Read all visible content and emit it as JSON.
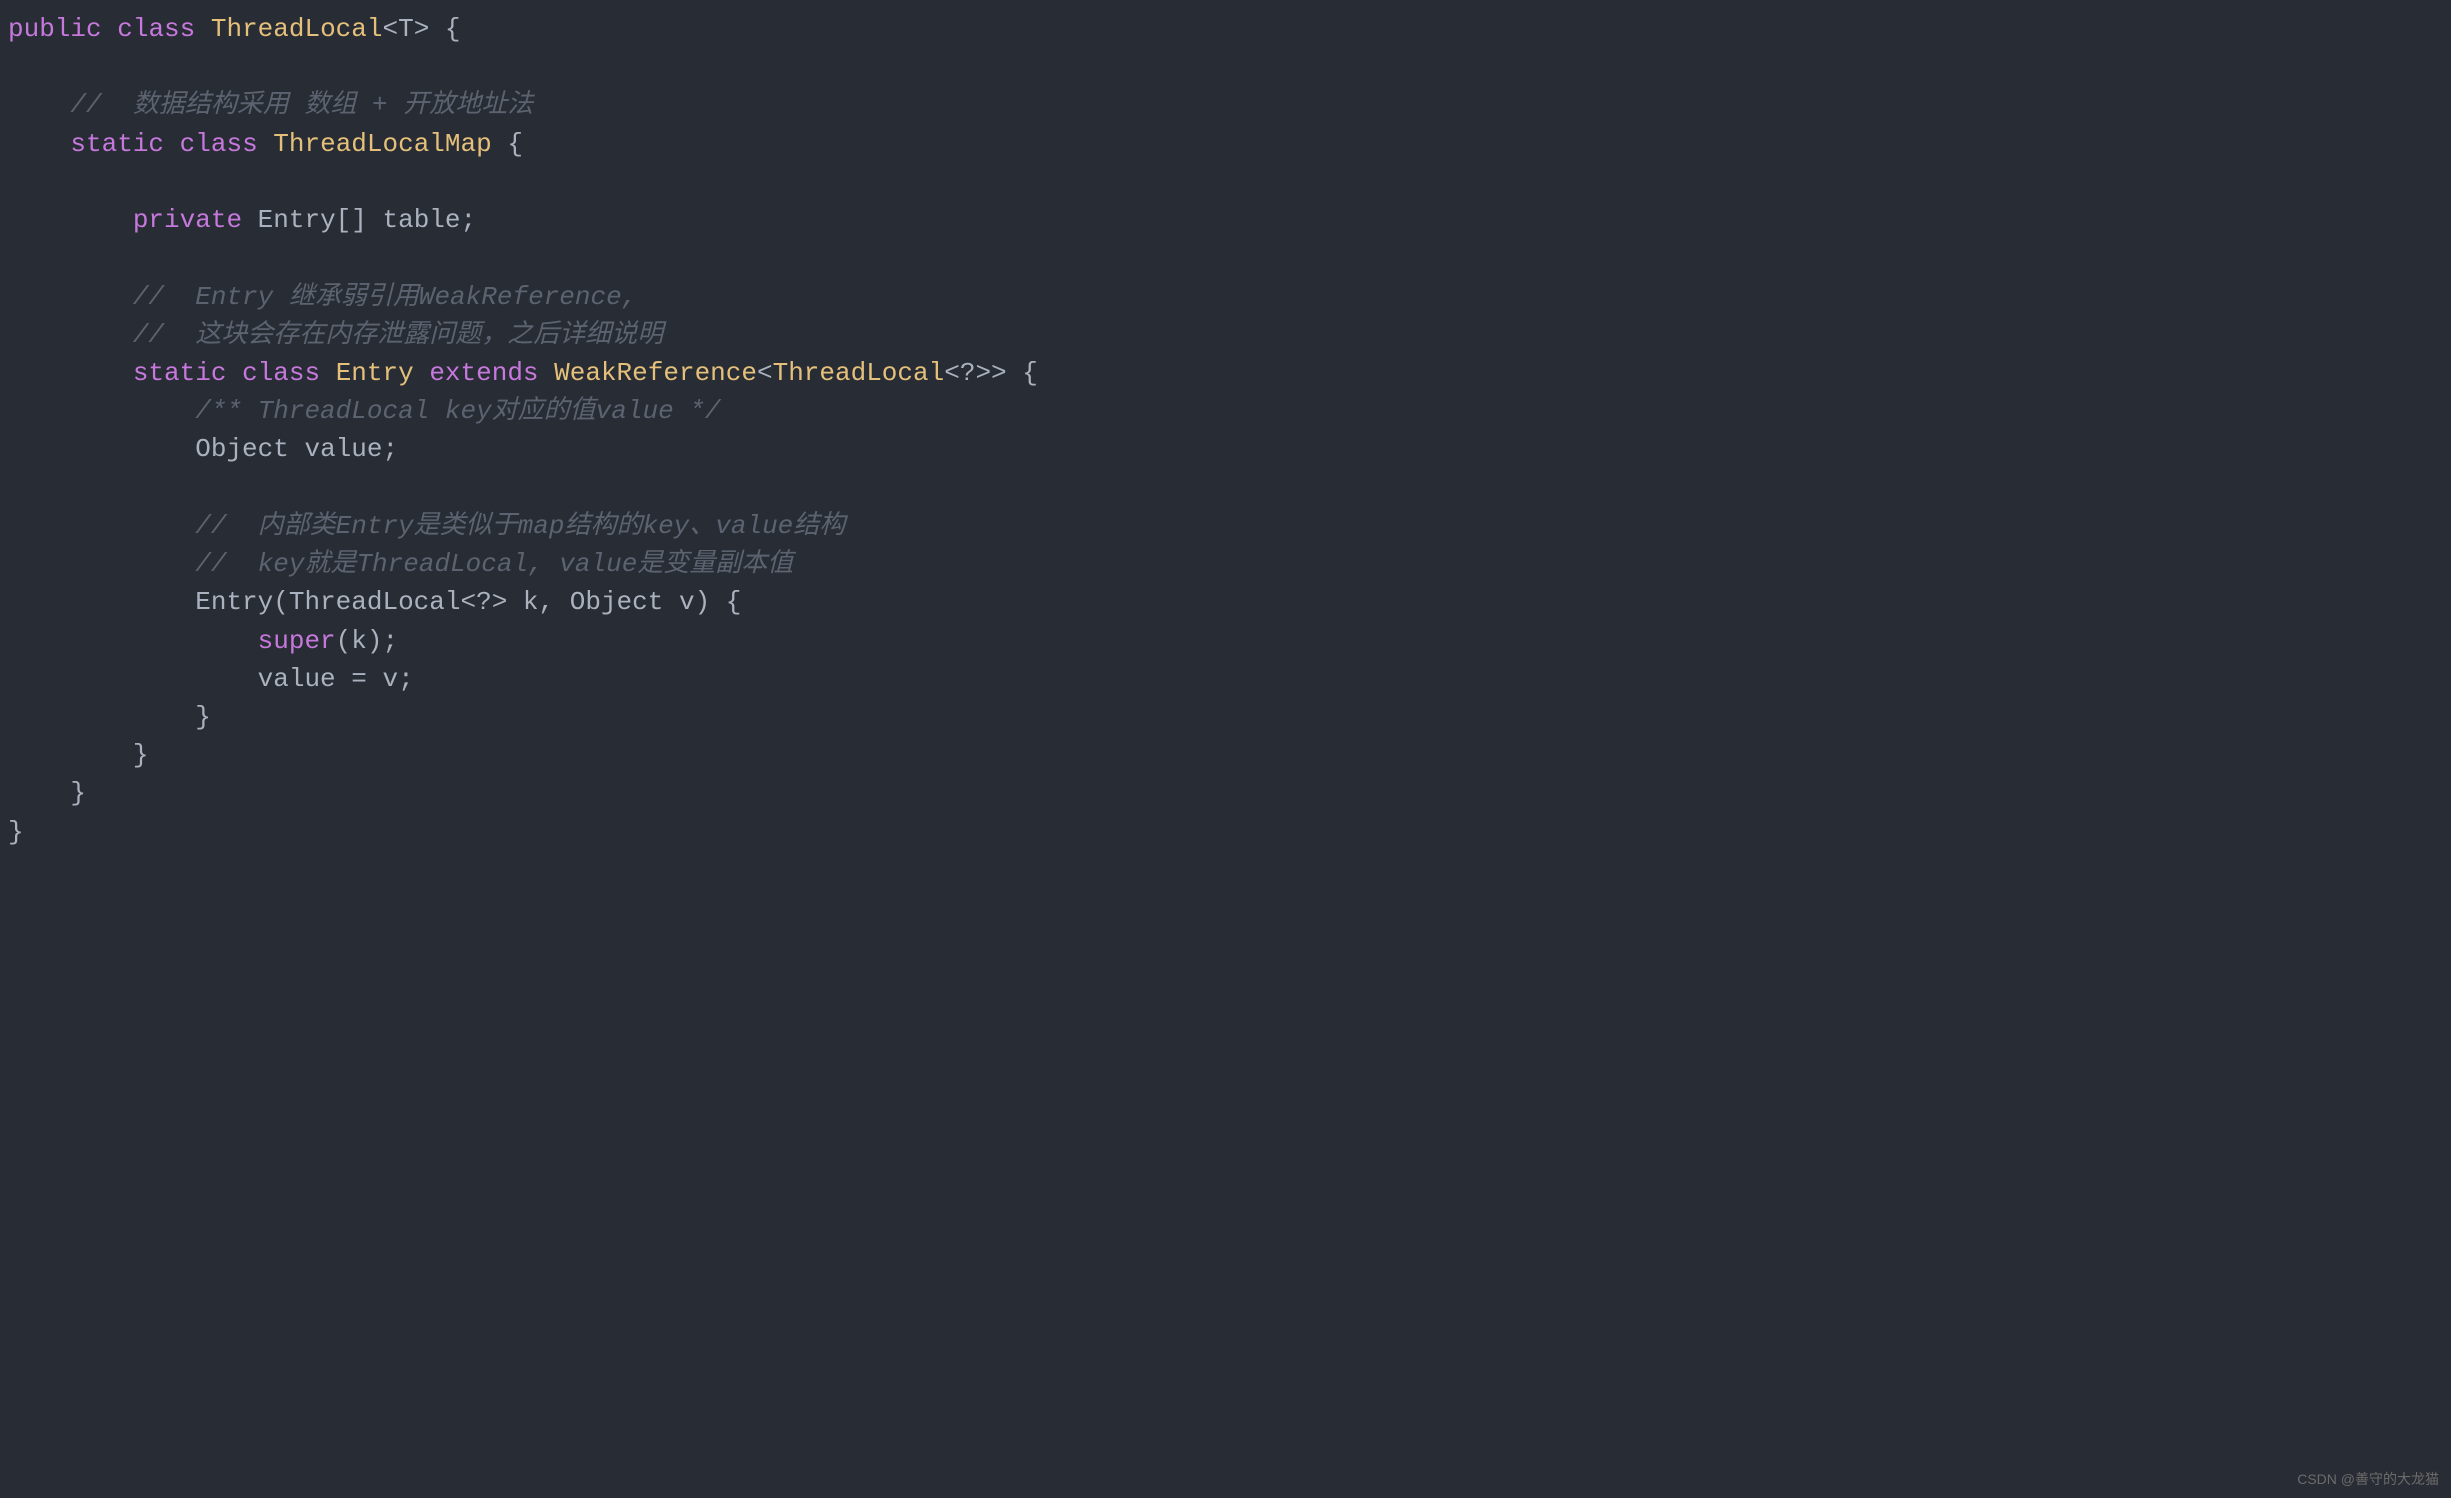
{
  "code": {
    "line1": {
      "kw_public": "public",
      "kw_class": "class",
      "name": "ThreadLocal",
      "generic": "<T>",
      "brace": " {"
    },
    "comment1": "    //  数据结构采用 数组 + 开放地址法",
    "line2": {
      "indent": "    ",
      "kw_static": "static",
      "kw_class": "class",
      "name": "ThreadLocalMap",
      "brace": " {"
    },
    "line3": {
      "indent": "        ",
      "kw_private": "private",
      "type": "Entry[]",
      "var": "table",
      "semi": ";"
    },
    "comment2a": "        //  Entry 继承弱引用WeakReference,",
    "comment2b": "        //  这块会存在内存泄露问题，之后详细说明",
    "line4": {
      "indent": "        ",
      "kw_static": "static",
      "kw_class": "class",
      "name": "Entry",
      "kw_extends": "extends",
      "super_type": "WeakReference",
      "generic_open": "<",
      "generic_inner": "ThreadLocal",
      "generic_wild": "<?>",
      "generic_close": ">",
      "brace": " {"
    },
    "comment3": "            /** ThreadLocal key对应的值value */",
    "line5": {
      "indent": "            ",
      "type": "Object",
      "var": "value",
      "semi": ";"
    },
    "comment4a": "            //  内部类Entry是类似于map结构的key、value结构",
    "comment4b": "            //  key就是ThreadLocal, value是变量副本值",
    "line6": {
      "indent": "            ",
      "ctor": "Entry",
      "paren_open": "(",
      "param1_type": "ThreadLocal",
      "param1_generic": "<?>",
      "param1_name": " k",
      "comma": ", ",
      "param2_type": "Object",
      "param2_name": " v",
      "paren_close": ")",
      "brace": " {"
    },
    "line7": {
      "indent": "                ",
      "kw_super": "super",
      "args": "(k);"
    },
    "line8": {
      "indent": "                ",
      "stmt": "value = v;"
    },
    "line9": "            }",
    "line10": "        }",
    "line11": "    }",
    "line12": "}"
  },
  "watermark": "CSDN @善守的大龙猫"
}
